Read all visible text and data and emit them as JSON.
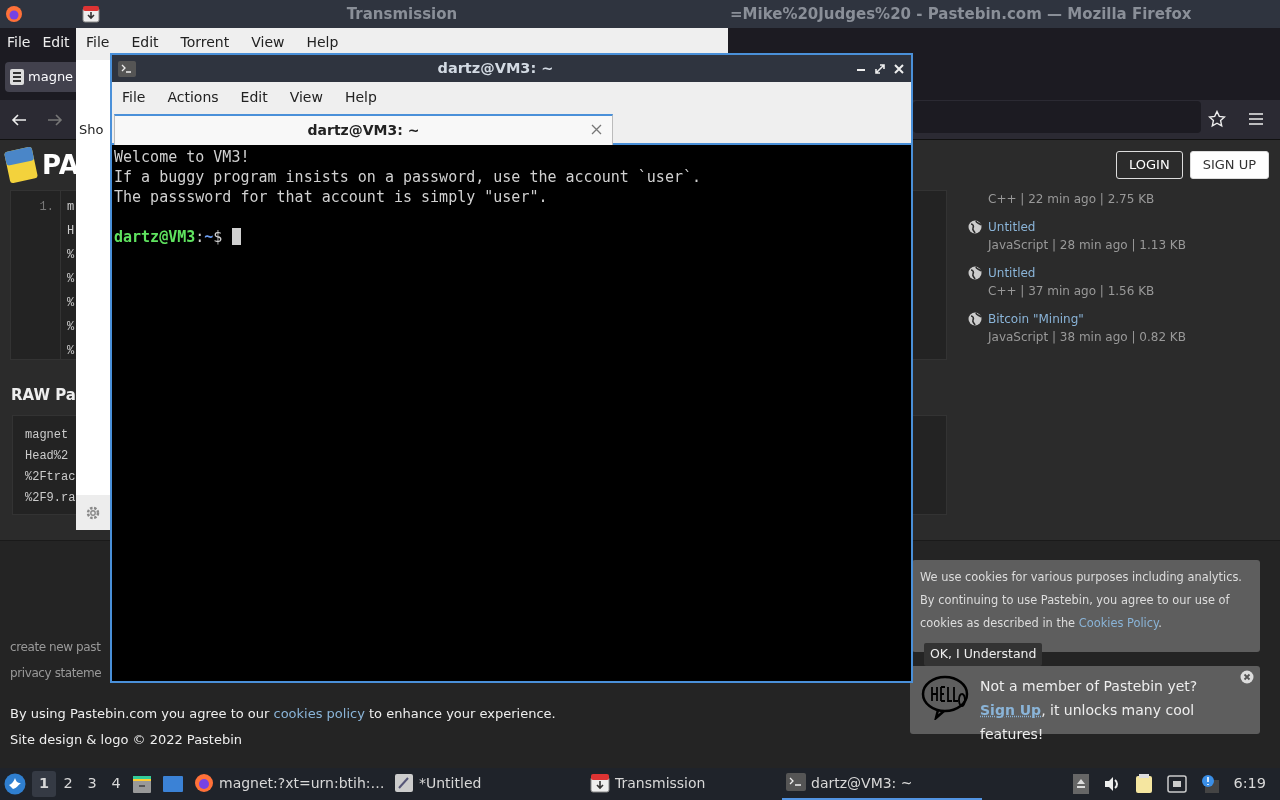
{
  "firefox": {
    "title": "=Mike%20Judges%20 - Pastebin.com — Mozilla Firefox",
    "menu": [
      "File",
      "Edit"
    ],
    "tab": "magne",
    "page": {
      "logo": "PA",
      "login": "LOGIN",
      "signup": "SIGN UP",
      "code_lines": [
        {
          "number": "1.",
          "text": "m"
        },
        {
          "text": "H"
        },
        {
          "text": "%"
        },
        {
          "text": "%"
        },
        {
          "text": "%"
        },
        {
          "text": "%"
        },
        {
          "text": "%"
        }
      ],
      "raw_heading": "RAW Pa",
      "raw_lines": [
        "magnet",
        "Head%2",
        "%2Ftrac",
        "%2F9.ra"
      ],
      "recent": [
        {
          "meta": "C++ | 22 min ago | 2.75 KB"
        },
        {
          "title": "Untitled",
          "meta": "JavaScript | 28 min ago | 1.13 KB"
        },
        {
          "title": "Untitled",
          "meta": "C++ | 37 min ago | 1.56 KB"
        },
        {
          "title": "Bitcoin \"Mining\"",
          "meta": "JavaScript | 38 min ago | 0.82 KB"
        }
      ],
      "footer_links": [
        "create new past",
        "privacy stateme"
      ],
      "notice": {
        "before": "By using Pastebin.com you agree to our",
        "link": "cookies policy",
        "after": "to enhance your experience."
      },
      "copyright": "Site design & logo © 2022 Pastebin",
      "cookie_banner": {
        "text": "We use cookies for various purposes including analytics. By continuing to use Pastebin, you agree to our use of cookies as described in the",
        "link": "Cookies Policy",
        "end": ".",
        "button": "OK, I Understand"
      },
      "signup_prompt": {
        "line": "Not a member of Pastebin yet?",
        "link": "Sign Up",
        "rest": ", it unlocks many cool features!"
      }
    }
  },
  "transmission": {
    "title": "Transmission",
    "menu": [
      "File",
      "Edit",
      "Torrent",
      "View",
      "Help"
    ],
    "toolbar_text": "Sho"
  },
  "terminal": {
    "title": "dartz@VM3: ~",
    "menu": [
      "File",
      "Actions",
      "Edit",
      "View",
      "Help"
    ],
    "tab": "dartz@VM3: ~",
    "lines": [
      "Welcome to VM3!",
      "If a buggy program insists on a password, use the account `user`.",
      "The passsword for that account is simply \"user\"."
    ],
    "prompt": {
      "user": "dartz@VM3",
      "sep": ":",
      "path": "~",
      "symbol": "$"
    }
  },
  "taskbar": {
    "workspaces": [
      {
        "label": "1",
        "selected": true
      },
      {
        "label": "2",
        "selected": false
      },
      {
        "label": "3",
        "selected": false
      },
      {
        "label": "4",
        "selected": false
      }
    ],
    "tasks": [
      {
        "kind": "browser",
        "label": "magnet:?xt=urn:btih:…",
        "selected": false
      },
      {
        "kind": "editor",
        "label": "*Untitled",
        "selected": false
      },
      {
        "kind": "torrent",
        "label": "Transmission",
        "selected": false
      },
      {
        "kind": "terminal",
        "label": "dartz@VM3: ~",
        "selected": true
      }
    ],
    "clock": "6:19"
  }
}
